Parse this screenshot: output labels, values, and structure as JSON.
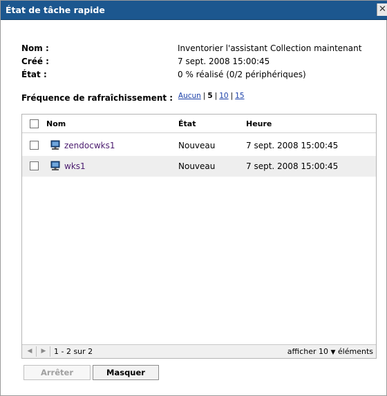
{
  "dialog": {
    "title": "État de tâche rapide",
    "close_label": "✕"
  },
  "info": {
    "name_label": "Nom :",
    "name_value": "Inventorier l'assistant Collection maintenant",
    "created_label": "Créé :",
    "created_value": "7 sept. 2008 15:00:45",
    "status_label": "État :",
    "status_value": "0 % réalisé (0/2 périphériques)"
  },
  "refresh": {
    "label": "Fréquence de rafraîchissement :",
    "options": [
      "Aucun",
      "5",
      "10",
      "15"
    ],
    "selected": "5"
  },
  "grid": {
    "columns": [
      "Nom",
      "État",
      "Heure"
    ],
    "rows": [
      {
        "name": "zendocwks1",
        "status": "Nouveau",
        "time": "7 sept. 2008 15:00:45"
      },
      {
        "name": "wks1",
        "status": "Nouveau",
        "time": "7 sept. 2008 15:00:45"
      }
    ],
    "pagination": {
      "range": "1 - 2 sur 2",
      "show_label": "afficher",
      "page_size": "10",
      "items_label": "éléments"
    }
  },
  "buttons": {
    "stop": "Arrêter",
    "hide": "Masquer"
  },
  "colors": {
    "titlebar": "#1c578f",
    "link": "#1a3fa8",
    "device_link": "#4a1a6e"
  }
}
